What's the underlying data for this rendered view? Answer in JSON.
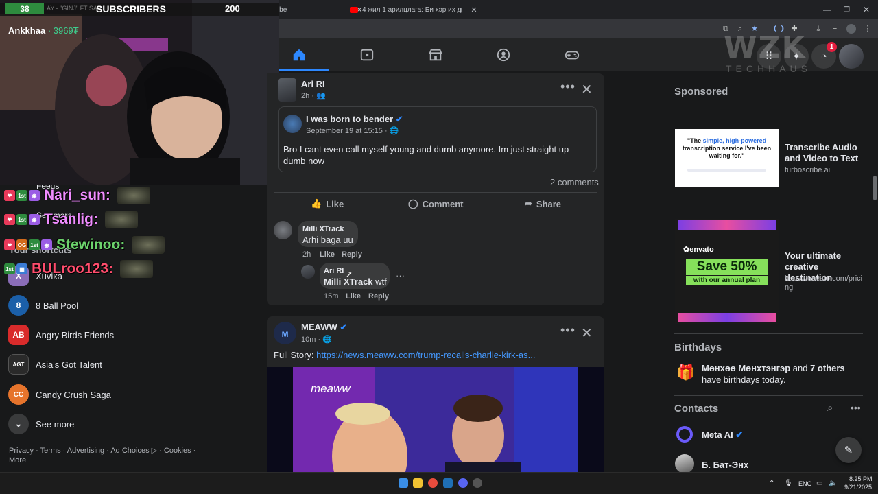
{
  "browser": {
    "tabs": [
      {
        "label": "YouTube"
      },
      {
        "label": "4 жил 1 арилцлага: Би хэр их д"
      }
    ]
  },
  "stream_overlay": {
    "subscriber_count": "38",
    "faded_label": "AY - \"GINJ\" FT SAR",
    "subscriber_label": "SUBSCRIBERS",
    "subscriber_goal": "200",
    "streamer_name": "Ankkhaa",
    "streamer_points": "· 3969₮",
    "chat": [
      {
        "name": "Nari_sun:",
        "color": "#f08cff",
        "badges": [
          "1st"
        ]
      },
      {
        "name": "Tsanlig:",
        "color": "#f08cff",
        "badges": [
          "1st"
        ]
      },
      {
        "name": "Stewinoo:",
        "color": "#6cd36c",
        "badges": [
          "OG",
          "1st"
        ]
      },
      {
        "name": "BULroo123:",
        "color": "#ff4d6d",
        "badges": [
          "1st"
        ]
      }
    ]
  },
  "watermark": {
    "brand": "WZK",
    "sub": "TECHHAUS"
  },
  "fb_nav": {
    "notification_count": "1"
  },
  "left_sidebar": {
    "partial_items": {
      "feeds": "Feeds",
      "see_more_top": "See more",
      "shortcuts": "Your shortcuts"
    },
    "shortcuts": [
      {
        "label": "Xuvika",
        "color": "#8a6db8",
        "glyph": "X"
      },
      {
        "label": "8 Ball Pool",
        "color": "#1b5fa8",
        "glyph": "8"
      },
      {
        "label": "Angry Birds Friends",
        "color": "#d92b2b",
        "glyph": "AB"
      },
      {
        "label": "Asia's Got Talent",
        "color": "#2a2a2a",
        "glyph": "AGT"
      },
      {
        "label": "Candy Crush Saga",
        "color": "#e6742c",
        "glyph": "CC"
      }
    ],
    "see_more": "See more",
    "footer": "Privacy · Terms · Advertising · Ad Choices ▷ · Cookies · More"
  },
  "post1": {
    "author": "Ari RI",
    "time": "2h",
    "shared": {
      "author": "I was born to bender",
      "date": "September 19 at 15:15",
      "text": "Bro I cant even call myself young and dumb anymore. Im just straight up dumb now"
    },
    "comments_count": "2 comments",
    "actions": {
      "like": "Like",
      "comment": "Comment",
      "share": "Share"
    },
    "comments": [
      {
        "author": "Milli XTrack",
        "text": "Arhi baga uu",
        "time": "2h",
        "like": "Like",
        "reply": "Reply"
      }
    ],
    "reply": {
      "author": "Ari RI",
      "mention": "Milli XTrack",
      "text": "wtf",
      "time": "15m",
      "like": "Like",
      "reply": "Reply"
    }
  },
  "post2": {
    "author": "MEAWW",
    "time": "10m",
    "text_prefix": "Full Story:",
    "link": "https://news.meaww.com/trump-recalls-charlie-kirk-as...",
    "image_logo": "meaww"
  },
  "right_column": {
    "sponsored": "Sponsored",
    "ads": [
      {
        "creative_text_a": "\"The ",
        "creative_highlight": "simple, high-powered",
        "creative_text_b": " transcription service I've been waiting for.\"",
        "title": "Transcribe Audio and Video to Text",
        "domain": "turboscribe.ai"
      },
      {
        "brand": "envato",
        "headline": "Save 50%",
        "subline": "with our annual plan",
        "title": "Your ultimate creative destination",
        "domain": "https://envato.com/pricing"
      }
    ],
    "birthdays_title": "Birthdays",
    "birthday_name": "Мөнхөө Мөнхтэнгэр",
    "birthday_and": "and",
    "birthday_others": "7 others",
    "birthday_suffix": "have birthdays today.",
    "contacts_title": "Contacts",
    "contacts": [
      {
        "name": "Meta AI"
      },
      {
        "name": "Б. Бат-Энх"
      }
    ]
  },
  "taskbar": {
    "lang": "ENG",
    "time": "8:25 PM",
    "date": "9/21/2025"
  }
}
